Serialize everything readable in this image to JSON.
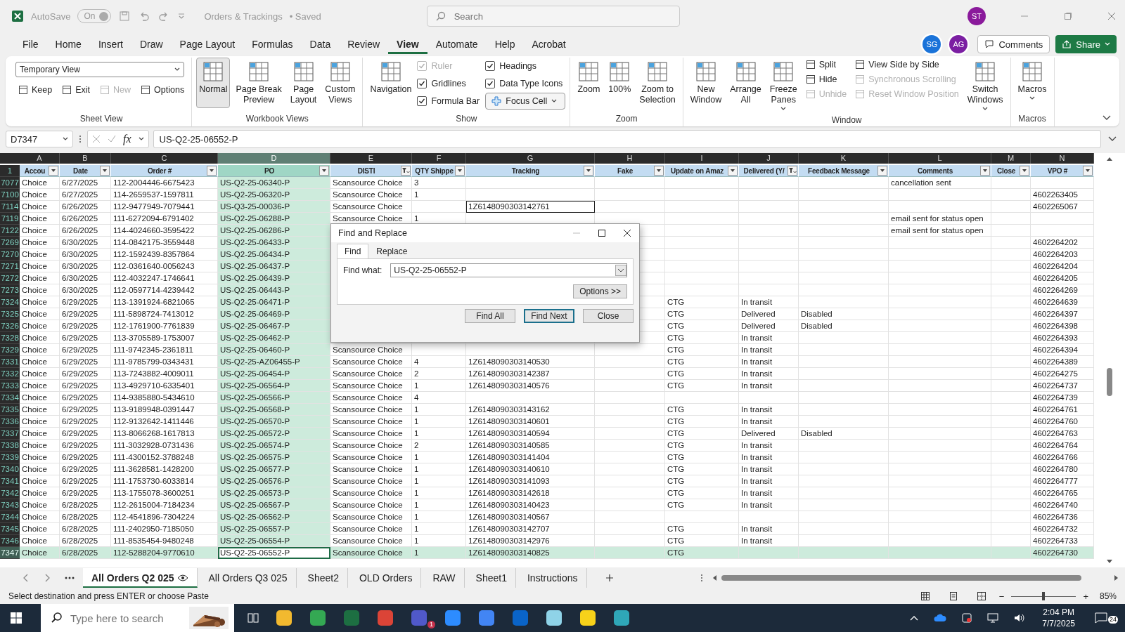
{
  "title_bar": {
    "autosave": {
      "label": "AutoSave",
      "state": "On",
      "on": true
    },
    "document_title": "Orders & Trackings",
    "save_state": "• Saved",
    "search": {
      "placeholder": "Search"
    },
    "user_avatar": {
      "initials": "ST",
      "color": "#8a1a9b"
    }
  },
  "menu_tabs": [
    {
      "label": "File",
      "selected": false
    },
    {
      "label": "Home",
      "selected": false
    },
    {
      "label": "Insert",
      "selected": false
    },
    {
      "label": "Draw",
      "selected": false
    },
    {
      "label": "Page Layout",
      "selected": false
    },
    {
      "label": "Formulas",
      "selected": false
    },
    {
      "label": "Data",
      "selected": false
    },
    {
      "label": "Review",
      "selected": false
    },
    {
      "label": "View",
      "selected": true
    },
    {
      "label": "Automate",
      "selected": false
    },
    {
      "label": "Help",
      "selected": false
    },
    {
      "label": "Acrobat",
      "selected": false
    }
  ],
  "collaborators": [
    {
      "initials": "SG",
      "color": "#1a73d9"
    },
    {
      "initials": "AG",
      "color": "#7b1fa2"
    }
  ],
  "comments_button": "Comments",
  "share_button": "Share",
  "ribbon": [
    {
      "label": "Sheet View",
      "kind": "rows",
      "rows": [
        [
          {
            "kind": "dropdown",
            "label": "Temporary View"
          }
        ],
        [
          {
            "kind": "small",
            "label": "Keep",
            "disabled": false
          },
          {
            "kind": "small",
            "label": "Exit",
            "disabled": false
          },
          {
            "kind": "small",
            "label": "New",
            "disabled": true
          },
          {
            "kind": "small",
            "label": "Options",
            "disabled": false
          }
        ]
      ]
    },
    {
      "label": "Workbook Views",
      "kind": "columns",
      "columns": [
        [
          {
            "kind": "large",
            "label": "Normal",
            "selected": true
          }
        ],
        [
          {
            "kind": "large",
            "label": "Page Break\nPreview",
            "selected": false
          }
        ],
        [
          {
            "kind": "large",
            "label": "Page\nLayout",
            "selected": false
          }
        ],
        [
          {
            "kind": "large",
            "label": "Custom\nViews",
            "selected": false
          }
        ]
      ]
    },
    {
      "label": "Show",
      "kind": "columns",
      "columns": [
        [
          {
            "kind": "large",
            "label": "Navigation",
            "selected": false
          }
        ],
        [
          {
            "kind": "check",
            "label": "Ruler",
            "checked": true,
            "disabled": true
          },
          {
            "kind": "check",
            "label": "Gridlines",
            "checked": true,
            "disabled": false
          },
          {
            "kind": "check",
            "label": "Formula Bar",
            "checked": true,
            "disabled": false
          }
        ],
        [
          {
            "kind": "check",
            "label": "Headings",
            "checked": true,
            "disabled": false
          },
          {
            "kind": "check",
            "label": "Data Type Icons",
            "checked": true,
            "disabled": false
          },
          {
            "kind": "split",
            "label": "Focus Cell"
          }
        ]
      ]
    },
    {
      "label": "Zoom",
      "kind": "columns",
      "columns": [
        [
          {
            "kind": "large",
            "label": "Zoom",
            "selected": false
          }
        ],
        [
          {
            "kind": "large",
            "label": "100%",
            "selected": false
          }
        ],
        [
          {
            "kind": "large",
            "label": "Zoom to\nSelection",
            "selected": false
          }
        ]
      ]
    },
    {
      "label": "Window",
      "kind": "columns",
      "columns": [
        [
          {
            "kind": "large",
            "label": "New\nWindow",
            "selected": false
          }
        ],
        [
          {
            "kind": "large",
            "label": "Arrange\nAll",
            "selected": false
          }
        ],
        [
          {
            "kind": "large",
            "label": "Freeze\nPanes",
            "selected": false,
            "menu": true
          }
        ],
        [
          {
            "kind": "small",
            "label": "Split",
            "disabled": false
          },
          {
            "kind": "small",
            "label": "Hide",
            "disabled": false
          },
          {
            "kind": "small",
            "label": "Unhide",
            "disabled": true
          }
        ],
        [
          {
            "kind": "small",
            "label": "View Side by Side",
            "disabled": false
          },
          {
            "kind": "small",
            "label": "Synchronous Scrolling",
            "disabled": true
          },
          {
            "kind": "small",
            "label": "Reset Window Position",
            "disabled": true
          }
        ],
        [
          {
            "kind": "large",
            "label": "Switch\nWindows",
            "selected": false,
            "menu": true
          }
        ]
      ]
    },
    {
      "label": "Macros",
      "kind": "columns",
      "columns": [
        [
          {
            "kind": "large",
            "label": "Macros",
            "selected": false,
            "menu": true
          }
        ]
      ]
    }
  ],
  "formula_bar": {
    "name_box": "D7347",
    "fx": "fx",
    "value": "US-Q2-25-06552-P"
  },
  "sheet": {
    "header_row": "1",
    "columns": [
      {
        "letter": "A",
        "header": "Accou",
        "filtered": false,
        "selected": false
      },
      {
        "letter": "B",
        "header": "Date",
        "filtered": false,
        "selected": false
      },
      {
        "letter": "C",
        "header": "Order #",
        "filtered": false,
        "selected": false
      },
      {
        "letter": "D",
        "header": "PO",
        "filtered": false,
        "selected": true
      },
      {
        "letter": "E",
        "header": "DISTI",
        "filtered": true,
        "selected": false
      },
      {
        "letter": "F",
        "header": "QTY Shippe",
        "filtered": false,
        "selected": false
      },
      {
        "letter": "G",
        "header": "Tracking",
        "filtered": false,
        "selected": false
      },
      {
        "letter": "H",
        "header": "Fake",
        "filtered": false,
        "selected": false
      },
      {
        "letter": "I",
        "header": "Update on Amaz",
        "filtered": false,
        "selected": false
      },
      {
        "letter": "J",
        "header": "Delivered (Y/",
        "filtered": true,
        "selected": false
      },
      {
        "letter": "K",
        "header": "Feedback Message",
        "filtered": false,
        "selected": false
      },
      {
        "letter": "L",
        "header": "Comments",
        "filtered": false,
        "selected": false
      },
      {
        "letter": "M",
        "header": "Close",
        "filtered": false,
        "selected": false
      },
      {
        "letter": "N",
        "header": "VPO #",
        "filtered": false,
        "selected": false
      }
    ],
    "rows": [
      {
        "row": "7077",
        "selected": false,
        "cells": {
          "A": "Choice",
          "B": "6/27/2025",
          "C": "112-2004446-6675423",
          "D": "US-Q2-25-06340-P",
          "E": "Scansource Choice",
          "F": "3",
          "L": "cancellation sent"
        }
      },
      {
        "row": "7100",
        "selected": false,
        "cells": {
          "A": "Choice",
          "B": "6/27/2025",
          "C": "114-2659537-1597811",
          "D": "US-Q2-25-06320-P",
          "E": "Scansource Choice",
          "F": "1",
          "N": "4602263405"
        }
      },
      {
        "row": "7114",
        "selected": false,
        "cells": {
          "A": "Choice",
          "B": "6/26/2025",
          "C": "112-9477949-7079441",
          "D": "US-Q3-25-00036-P",
          "E": "Scansource Choice",
          "G": {
            "text": "1Z6148090303142761",
            "outlined": true
          },
          "N": "4602265067"
        }
      },
      {
        "row": "7119",
        "selected": false,
        "cells": {
          "A": "Choice",
          "B": "6/26/2025",
          "C": "111-6272094-6791402",
          "D": "US-Q2-25-06288-P",
          "E": "Scansource Choice",
          "F": "1",
          "L": "email sent for status open"
        }
      },
      {
        "row": "7122",
        "selected": false,
        "cells": {
          "A": "Choice",
          "B": "6/26/2025",
          "C": "114-4024660-3595422",
          "D": "US-Q2-25-06286-P",
          "L": "email sent for status open"
        }
      },
      {
        "row": "7269",
        "selected": false,
        "cells": {
          "A": "Choice",
          "B": "6/30/2025",
          "C": "114-0842175-3559448",
          "D": "US-Q2-25-06433-P",
          "N": "4602264202"
        }
      },
      {
        "row": "7270",
        "selected": false,
        "cells": {
          "A": "Choice",
          "B": "6/30/2025",
          "C": "112-1592439-8357864",
          "D": "US-Q2-25-06434-P",
          "N": "4602264203"
        }
      },
      {
        "row": "7271",
        "selected": false,
        "cells": {
          "A": "Choice",
          "B": "6/30/2025",
          "C": "112-0361640-0056243",
          "D": "US-Q2-25-06437-P",
          "N": "4602264204"
        }
      },
      {
        "row": "7272",
        "selected": false,
        "cells": {
          "A": "Choice",
          "B": "6/30/2025",
          "C": "112-4032247-1746641",
          "D": "US-Q2-25-06439-P",
          "N": "4602264205"
        }
      },
      {
        "row": "7273",
        "selected": false,
        "cells": {
          "A": "Choice",
          "B": "6/30/2025",
          "C": "112-0597714-4239442",
          "D": "US-Q2-25-06443-P",
          "N": "4602264269"
        }
      },
      {
        "row": "7324",
        "selected": false,
        "cells": {
          "A": "Choice",
          "B": "6/29/2025",
          "C": "113-1391924-6821065",
          "D": "US-Q2-25-06471-P",
          "I": "CTG",
          "J": "In transit",
          "N": "4602264639"
        }
      },
      {
        "row": "7325",
        "selected": false,
        "cells": {
          "A": "Choice",
          "B": "6/29/2025",
          "C": "111-5898724-7413012",
          "D": "US-Q2-25-06469-P",
          "I": "CTG",
          "J": "Delivered",
          "K": "Disabled",
          "N": "4602264397"
        }
      },
      {
        "row": "7326",
        "selected": false,
        "cells": {
          "A": "Choice",
          "B": "6/29/2025",
          "C": "112-1761900-7761839",
          "D": "US-Q2-25-06467-P",
          "I": "CTG",
          "J": "Delivered",
          "K": "Disabled",
          "N": "4602264398"
        }
      },
      {
        "row": "7328",
        "selected": false,
        "cells": {
          "A": "Choice",
          "B": "6/29/2025",
          "C": "113-3705589-1753007",
          "D": "US-Q2-25-06462-P",
          "I": "CTG",
          "J": "In transit",
          "N": "4602264393"
        }
      },
      {
        "row": "7329",
        "selected": false,
        "cells": {
          "A": "Choice",
          "B": "6/29/2025",
          "C": "111-9742345-2361811",
          "D": "US-Q2-25-06460-P",
          "E": "Scansource Choice",
          "I": "CTG",
          "J": "In transit",
          "N": "4602264394"
        }
      },
      {
        "row": "7331",
        "selected": false,
        "cells": {
          "A": "Choice",
          "B": "6/29/2025",
          "C": "111-9785799-0343431",
          "D": "US-Q2-25-AZ06455-P",
          "E": "Scansource Choice",
          "F": "4",
          "G": "1Z6148090303140530",
          "I": "CTG",
          "J": "In transit",
          "N": "4602264389"
        }
      },
      {
        "row": "7332",
        "selected": false,
        "cells": {
          "A": "Choice",
          "B": "6/29/2025",
          "C": "113-7243882-4009011",
          "D": "US-Q2-25-06454-P",
          "E": "Scansource Choice",
          "F": "2",
          "G": "1Z6148090303142387",
          "I": "CTG",
          "J": "In transit",
          "N": "4602264275"
        }
      },
      {
        "row": "7333",
        "selected": false,
        "cells": {
          "A": "Choice",
          "B": "6/29/2025",
          "C": "113-4929710-6335401",
          "D": "US-Q2-25-06564-P",
          "E": "Scansource Choice",
          "F": "1",
          "G": "1Z6148090303140576",
          "I": "CTG",
          "J": "In transit",
          "N": "4602264737"
        }
      },
      {
        "row": "7334",
        "selected": false,
        "cells": {
          "A": "Choice",
          "B": "6/29/2025",
          "C": "114-9385880-5434610",
          "D": "US-Q2-25-06566-P",
          "E": "Scansource Choice",
          "F": "4",
          "N": "4602264739"
        }
      },
      {
        "row": "7335",
        "selected": false,
        "cells": {
          "A": "Choice",
          "B": "6/29/2025",
          "C": "113-9189948-0391447",
          "D": "US-Q2-25-06568-P",
          "E": "Scansource Choice",
          "F": "1",
          "G": "1Z6148090303143162",
          "I": "CTG",
          "J": "In transit",
          "N": "4602264761"
        }
      },
      {
        "row": "7336",
        "selected": false,
        "cells": {
          "A": "Choice",
          "B": "6/29/2025",
          "C": "112-9132642-1411446",
          "D": "US-Q2-25-06570-P",
          "E": "Scansource Choice",
          "F": "1",
          "G": "1Z6148090303140601",
          "I": "CTG",
          "J": "In transit",
          "N": "4602264760"
        }
      },
      {
        "row": "7337",
        "selected": false,
        "cells": {
          "A": "Choice",
          "B": "6/29/2025",
          "C": "113-8066268-1617813",
          "D": "US-Q2-25-06572-P",
          "E": "Scansource Choice",
          "F": "1",
          "G": "1Z6148090303140594",
          "I": "CTG",
          "J": "Delivered",
          "K": "Disabled",
          "N": "4602264763"
        }
      },
      {
        "row": "7338",
        "selected": false,
        "cells": {
          "A": "Choice",
          "B": "6/29/2025",
          "C": "111-3032928-0731436",
          "D": "US-Q2-25-06574-P",
          "E": "Scansource Choice",
          "F": "2",
          "G": "1Z6148090303140585",
          "I": "CTG",
          "J": "In transit",
          "N": "4602264764"
        }
      },
      {
        "row": "7339",
        "selected": false,
        "cells": {
          "A": "Choice",
          "B": "6/29/2025",
          "C": "111-4300152-3788248",
          "D": "US-Q2-25-06575-P",
          "E": "Scansource Choice",
          "F": "1",
          "G": "1Z6148090303141404",
          "I": "CTG",
          "J": "In transit",
          "N": "4602264766"
        }
      },
      {
        "row": "7340",
        "selected": false,
        "cells": {
          "A": "Choice",
          "B": "6/29/2025",
          "C": "111-3628581-1428200",
          "D": "US-Q2-25-06577-P",
          "E": "Scansource Choice",
          "F": "1",
          "G": "1Z6148090303140610",
          "I": "CTG",
          "J": "In transit",
          "N": "4602264780"
        }
      },
      {
        "row": "7341",
        "selected": false,
        "cells": {
          "A": "Choice",
          "B": "6/29/2025",
          "C": "111-1753730-6033814",
          "D": "US-Q2-25-06576-P",
          "E": "Scansource Choice",
          "F": "1",
          "G": "1Z6148090303141093",
          "I": "CTG",
          "J": "In transit",
          "N": "4602264777"
        }
      },
      {
        "row": "7342",
        "selected": false,
        "cells": {
          "A": "Choice",
          "B": "6/29/2025",
          "C": "113-1755078-3600251",
          "D": "US-Q2-25-06573-P",
          "E": "Scansource Choice",
          "F": "1",
          "G": "1Z6148090303142618",
          "I": "CTG",
          "J": "In transit",
          "N": "4602264765"
        }
      },
      {
        "row": "7343",
        "selected": false,
        "cells": {
          "A": "Choice",
          "B": "6/28/2025",
          "C": "112-2615004-7184234",
          "D": "US-Q2-25-06567-P",
          "E": "Scansource Choice",
          "F": "1",
          "G": "1Z6148090303140423",
          "I": "CTG",
          "J": "In transit",
          "N": "4602264740"
        }
      },
      {
        "row": "7344",
        "selected": false,
        "cells": {
          "A": "Choice",
          "B": "6/28/2025",
          "C": "112-4541896-7304224",
          "D": "US-Q2-25-06562-P",
          "E": "Scansource Choice",
          "F": "1",
          "G": "1Z6148090303140567",
          "N": "4602264736"
        }
      },
      {
        "row": "7345",
        "selected": false,
        "cells": {
          "A": "Choice",
          "B": "6/28/2025",
          "C": "111-2402950-7185050",
          "D": "US-Q2-25-06557-P",
          "E": "Scansource Choice",
          "F": "1",
          "G": "1Z6148090303142707",
          "I": "CTG",
          "J": "In transit",
          "N": "4602264732"
        }
      },
      {
        "row": "7346",
        "selected": false,
        "cells": {
          "A": "Choice",
          "B": "6/28/2025",
          "C": "111-8535454-9480248",
          "D": "US-Q2-25-06554-P",
          "E": "Scansource Choice",
          "F": "1",
          "G": "1Z6148090303142976",
          "I": "CTG",
          "J": "In transit",
          "N": "4602264733"
        }
      },
      {
        "row": "7347",
        "selected": true,
        "cells": {
          "A": "Choice",
          "B": "6/28/2025",
          "C": "112-5288204-9770610",
          "D": {
            "text": "US-Q2-25-06552-P",
            "active": true
          },
          "E": "Scansource Choice",
          "F": "1",
          "G": "1Z6148090303140825",
          "I": "CTG",
          "N": "4602264730"
        }
      }
    ]
  },
  "dialog": {
    "title": "Find and Replace",
    "tabs": [
      {
        "label": "Find",
        "selected": true
      },
      {
        "label": "Replace",
        "selected": false
      }
    ],
    "find_label": "Find what:",
    "find_value": "US-Q2-25-06552-P",
    "options_button": "Options >>",
    "buttons": [
      {
        "label": "Find All",
        "default": false
      },
      {
        "label": "Find Next",
        "default": true
      },
      {
        "label": "Close",
        "default": false
      }
    ]
  },
  "sheet_tabs": [
    {
      "label": "All Orders Q2 025",
      "selected": true
    },
    {
      "label": "All Orders Q3 025",
      "selected": false
    },
    {
      "label": "Sheet2",
      "selected": false
    },
    {
      "label": "OLD Orders",
      "selected": false
    },
    {
      "label": "RAW",
      "selected": false
    },
    {
      "label": "Sheet1",
      "selected": false
    },
    {
      "label": "Instructions",
      "selected": false
    }
  ],
  "status_bar": {
    "message": "Select destination and press ENTER or choose Paste",
    "zoom_out": "−",
    "zoom_in": "+",
    "zoom": {
      "level": 0.5
    },
    "zoom_reading": "85%"
  },
  "taskbar": {
    "search_placeholder": "Type here to search",
    "apps": [
      {
        "color": "#f2b92f"
      },
      {
        "color": "#34a853"
      },
      {
        "color": "#1d6f42"
      },
      {
        "color": "#db4437"
      },
      {
        "color": "#5059c9",
        "badge": "1"
      },
      {
        "color": "#2d8cff"
      },
      {
        "color": "#4285f4"
      },
      {
        "color": "#0a64c8"
      },
      {
        "color": "#8fd3e8"
      },
      {
        "color": "#f7d21a"
      },
      {
        "color": "#2fa7b8"
      }
    ],
    "time": "2:04 PM",
    "date": "7/7/2025",
    "notifications": "24"
  }
}
